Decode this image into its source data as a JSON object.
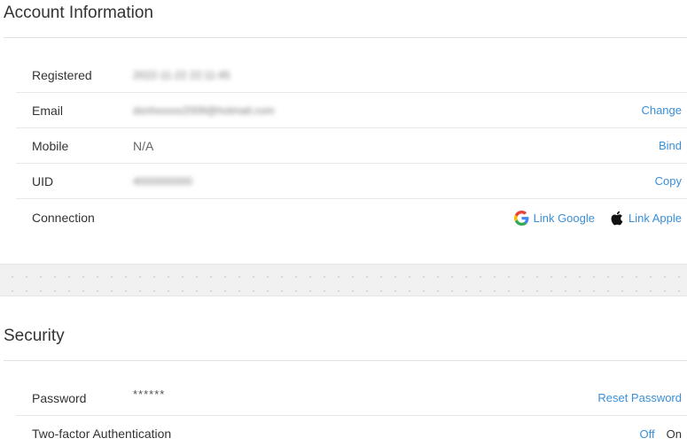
{
  "account": {
    "title": "Account Information",
    "rows": {
      "registered": {
        "label": "Registered",
        "value": "2022-11-22 22:11:45"
      },
      "email": {
        "label": "Email",
        "value": "dsnhxxxxx2009@hotmail.com",
        "action": "Change"
      },
      "mobile": {
        "label": "Mobile",
        "value": "N/A",
        "action": "Bind"
      },
      "uid": {
        "label": "UID",
        "value": "4000000000",
        "action": "Copy"
      },
      "connection": {
        "label": "Connection",
        "google": "Link Google",
        "apple": "Link Apple"
      }
    }
  },
  "security": {
    "title": "Security",
    "rows": {
      "password": {
        "label": "Password",
        "value": "******",
        "action": "Reset Password"
      },
      "twofa": {
        "label": "Two-factor Authentication",
        "off": "Off",
        "on": "On"
      }
    }
  },
  "colors": {
    "link": "#3a8fd8",
    "text": "#333333",
    "muted": "#666666"
  },
  "icons": {
    "google": "google-icon",
    "apple": "apple-icon"
  }
}
